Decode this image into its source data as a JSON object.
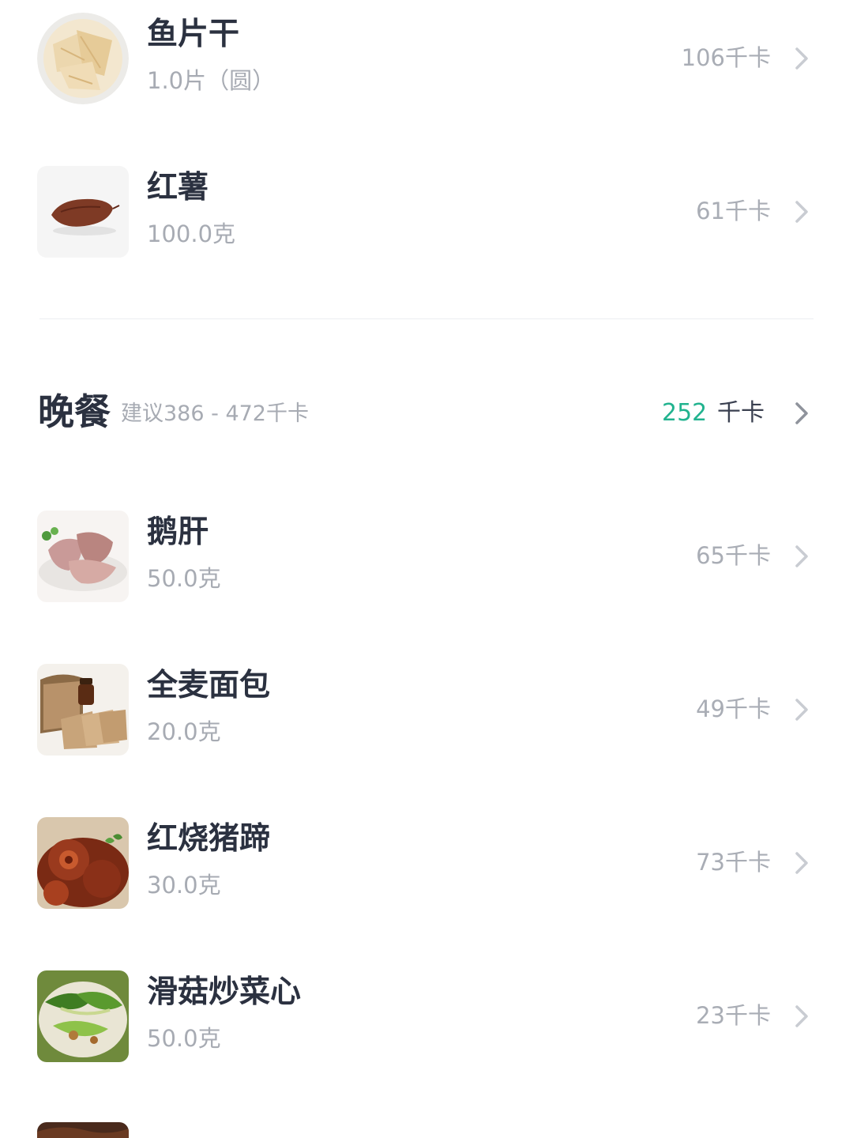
{
  "snack_items": [
    {
      "name": "鱼片干",
      "amount": "1.0片（圆）",
      "kcal": "106千卡",
      "image": "dried-fish-slices"
    },
    {
      "name": "红薯",
      "amount": "100.0克",
      "kcal": "61千卡",
      "image": "sweet-potato"
    }
  ],
  "dinner": {
    "title": "晚餐",
    "suggestion": "建议386 - 472千卡",
    "total": "252",
    "unit": "千卡",
    "accent_color": "#22b38f",
    "items": [
      {
        "name": "鹅肝",
        "amount": "50.0克",
        "kcal": "65千卡",
        "image": "goose-liver"
      },
      {
        "name": "全麦面包",
        "amount": "20.0克",
        "kcal": "49千卡",
        "image": "whole-wheat-bread"
      },
      {
        "name": "红烧猪蹄",
        "amount": "30.0克",
        "kcal": "73千卡",
        "image": "braised-pork-trotters"
      },
      {
        "name": "滑菇炒菜心",
        "amount": "50.0克",
        "kcal": "23千卡",
        "image": "mushroom-choy-sum"
      }
    ]
  }
}
